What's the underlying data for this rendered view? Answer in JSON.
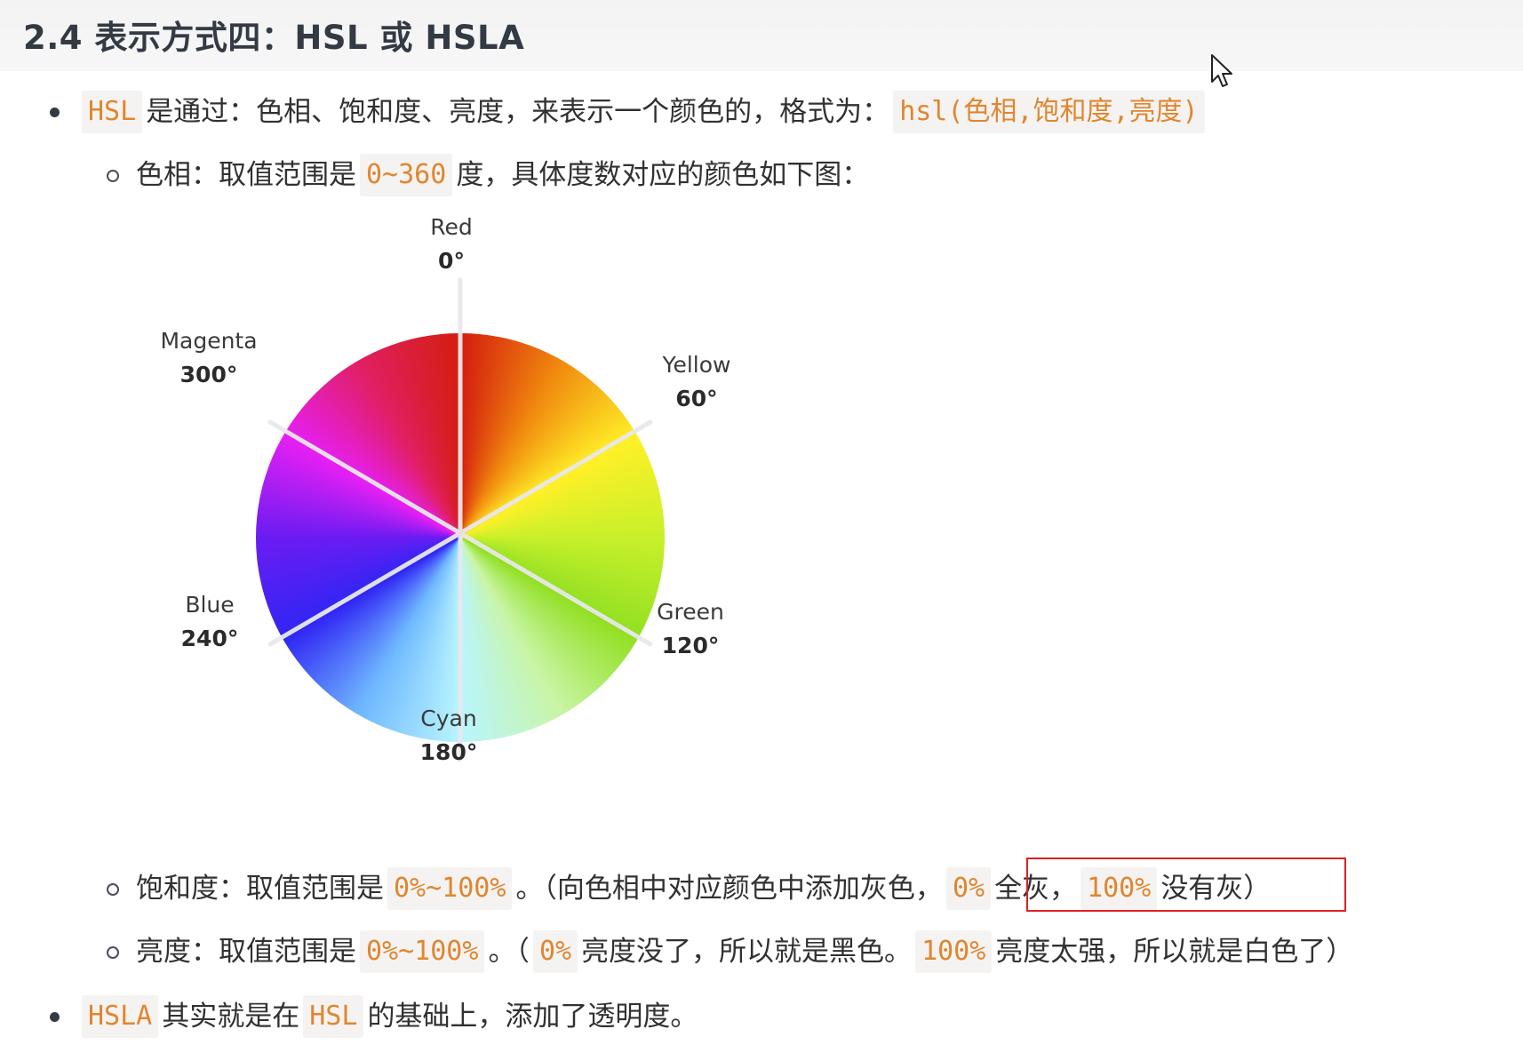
{
  "title": "2.4 表示方式四：HSL 或 HSLA",
  "colors": {
    "code_text": "#e0862f",
    "code_bg": "#f5f3f2",
    "highlight_box": "#e02020"
  },
  "bullet1": {
    "code1": "HSL",
    "text1": "是通过：色相、饱和度、亮度，来表示一个颜色的，格式为：",
    "code2": "hsl(色相,饱和度,亮度)"
  },
  "hue": {
    "text1": "色相：取值范围是",
    "code1": "0~360",
    "text2": "度，具体度数对应的颜色如下图："
  },
  "wheel": {
    "labels": [
      {
        "name": "Red",
        "deg": "0°"
      },
      {
        "name": "Yellow",
        "deg": "60°"
      },
      {
        "name": "Green",
        "deg": "120°"
      },
      {
        "name": "Cyan",
        "deg": "180°"
      },
      {
        "name": "Blue",
        "deg": "240°"
      },
      {
        "name": "Magenta",
        "deg": "300°"
      }
    ]
  },
  "saturation": {
    "text1": "饱和度：取值范围是",
    "code1": "0%~100%",
    "text2": "。（向色相中对应颜色中添加灰色，",
    "code2": "0%",
    "text3": "全灰，",
    "code3": "100%",
    "text4": "没有灰）"
  },
  "lightness": {
    "text1": "亮度：取值范围是",
    "code1": "0%~100%",
    "text2": "。（",
    "code2": "0%",
    "text3": "亮度没了，所以就是黑色。",
    "code3": "100%",
    "text4": "亮度太强，所以就是白色了）"
  },
  "bullet2": {
    "code1": "HSLA",
    "text1": "其实就是在",
    "code2": "HSL",
    "text2": "的基础上，添加了透明度。"
  }
}
